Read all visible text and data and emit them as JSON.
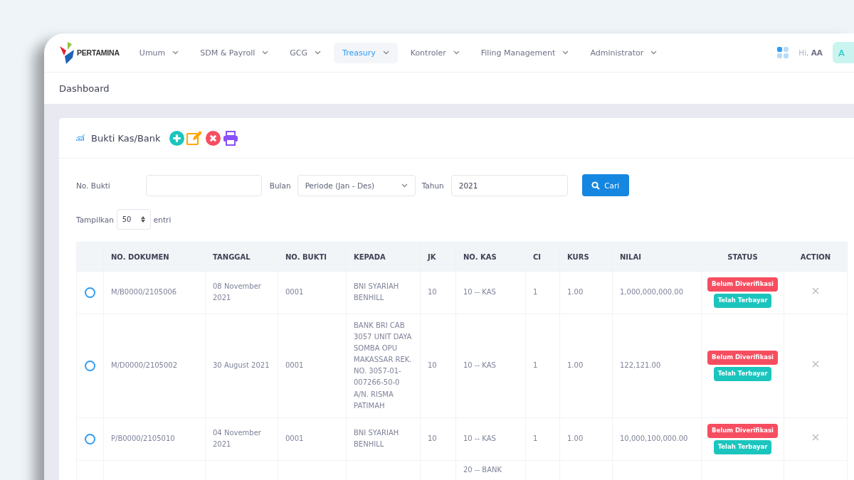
{
  "brand": {
    "name": "PERTAMINA"
  },
  "nav": [
    {
      "label": "Umum",
      "selected": false
    },
    {
      "label": "SDM & Payroll",
      "selected": false
    },
    {
      "label": "GCG",
      "selected": false
    },
    {
      "label": "Treasury",
      "selected": true
    },
    {
      "label": "Kontroler",
      "selected": false
    },
    {
      "label": "Filing Management",
      "selected": false
    },
    {
      "label": "Administrator",
      "selected": false
    }
  ],
  "user": {
    "greeting": "Hi,",
    "name": "AA",
    "avatar": "A"
  },
  "breadcrumb": "Dashboard",
  "card": {
    "title": "Bukti Kas/Bank"
  },
  "filters": {
    "no_bukti": {
      "label": "No. Bukti"
    },
    "bulan": {
      "label": "Bulan",
      "value": "Periode (Jan - Des)"
    },
    "tahun": {
      "label": "Tahun",
      "value": "2021"
    },
    "search_button": "Cari"
  },
  "page_size": {
    "prefix": "Tampilkan",
    "value": "50",
    "suffix": "entri"
  },
  "table": {
    "columns": [
      "NO. DOKUMEN",
      "TANGGAL",
      "NO. BUKTI",
      "KEPADA",
      "JK",
      "NO. KAS",
      "CI",
      "KURS",
      "NILAI",
      "STATUS",
      "ACTION"
    ],
    "rows": [
      {
        "selected": false,
        "cells": [
          "M/B0000/2105006",
          "08 November 2021",
          "0001",
          "BNI SYARIAH BENHILL",
          "10",
          "10 -- KAS",
          "1",
          "1.00",
          "1,000,000,000.00"
        ],
        "status": [
          {
            "label": "Belum Diverifikasi",
            "kind": "danger"
          },
          {
            "label": "Telah Terbayar",
            "kind": "success"
          }
        ]
      },
      {
        "selected": false,
        "cells": [
          "M/D0000/2105002",
          "30 August 2021",
          "0001",
          "BANK BRI CAB 3057 UNIT DAYA SOMBA OPU MAKASSAR REK. NO. 3057-01-007266-50-0 A/N. RISMA PATIMAH",
          "10",
          "10 -- KAS",
          "1",
          "1.00",
          "122,121.00"
        ],
        "status": [
          {
            "label": "Belum Diverifikasi",
            "kind": "danger"
          },
          {
            "label": "Telah Terbayar",
            "kind": "success"
          }
        ]
      },
      {
        "selected": false,
        "cells": [
          "P/B0000/2105010",
          "04 November 2021",
          "0001",
          "BNI SYARIAH BENHILL",
          "10",
          "10 -- KAS",
          "1",
          "1.00",
          "10,000,100,000.00"
        ],
        "status": [
          {
            "label": "Belum Diverifikasi",
            "kind": "danger"
          },
          {
            "label": "Telah Terbayar",
            "kind": "success"
          }
        ]
      }
    ],
    "partial_row": {
      "no_kas": "20 -- BANK"
    }
  }
}
